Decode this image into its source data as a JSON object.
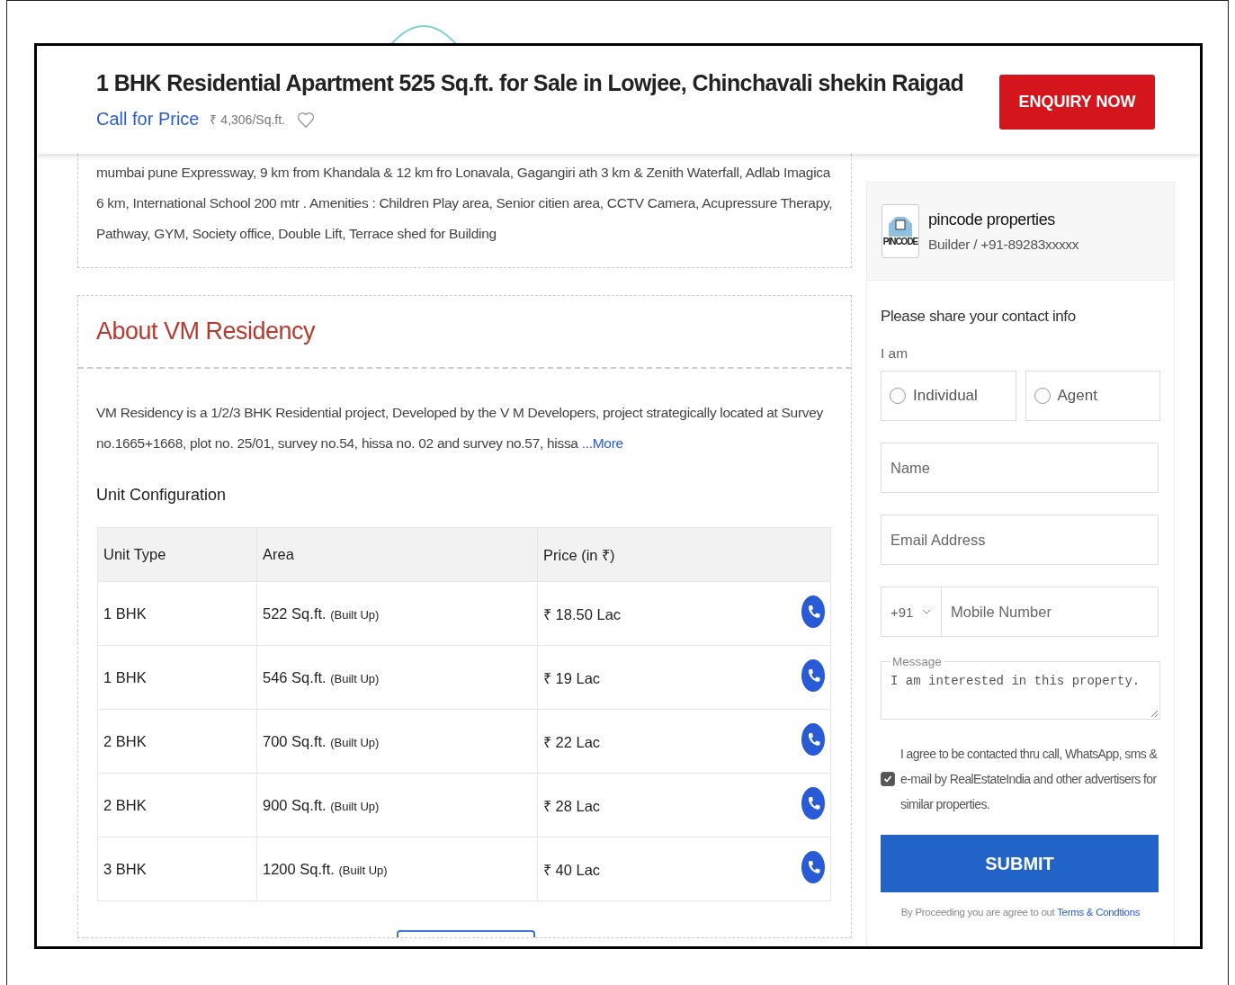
{
  "header": {
    "title": "1 BHK Residential Apartment 525 Sq.ft. for Sale in Lowjee, Chinchavali shekin Raigad",
    "price_label": "Call for Price",
    "price_per_sqft": "₹ 4,306/Sq.ft.",
    "enquiry_button": "ENQUIRY NOW"
  },
  "description": {
    "text": "mumbai pune Expressway, 9 km from Khandala & 12 km fro Lonavala, Gagangiri ath 3 km & Zenith Waterfall, Adlab Imagica 6 km, International School 200 mtr . Amenities : Children Play area, Senior citien area, CCTV Camera, Acupressure Therapy, Pathway, GYM, Society office, Double Lift, Terrace shed for Building"
  },
  "about": {
    "title": "About VM Residency",
    "text": "VM Residency is a 1/2/3 BHK Residential project, Developed by the V M Developers, project strategically located at Survey no.1665+1668, plot no. 25/01, survey no.54, hissa no. 02 and survey no.57, hissa",
    "more_link": "...More"
  },
  "unit_configuration": {
    "title": "Unit Configuration",
    "columns": [
      "Unit Type",
      "Area",
      "Price (in ₹)"
    ],
    "rows": [
      {
        "unit_type": "1 BHK",
        "area": "522 Sq.ft.",
        "area_note": "(Built Up)",
        "price": "₹ 18.50 Lac"
      },
      {
        "unit_type": "1 BHK",
        "area": "546 Sq.ft.",
        "area_note": "(Built Up)",
        "price": "₹ 19 Lac"
      },
      {
        "unit_type": "2 BHK",
        "area": "700 Sq.ft.",
        "area_note": "(Built Up)",
        "price": "₹ 22 Lac"
      },
      {
        "unit_type": "2 BHK",
        "area": "900 Sq.ft.",
        "area_note": "(Built Up)",
        "price": "₹ 28 Lac"
      },
      {
        "unit_type": "3 BHK",
        "area": "1200 Sq.ft.",
        "area_note": "(Built Up)",
        "price": "₹ 40 Lac"
      }
    ]
  },
  "seller": {
    "logo_text": "PINCODE",
    "name": "pincode properties",
    "subtitle": "Builder / +91-89283xxxxx"
  },
  "form": {
    "title": "Please share your contact info",
    "role_label": "I am",
    "roles": [
      {
        "label": "Individual",
        "selected": false
      },
      {
        "label": "Agent",
        "selected": false
      }
    ],
    "name_placeholder": "Name",
    "email_placeholder": "Email Address",
    "country_code": "+91",
    "mobile_placeholder": "Mobile Number",
    "message_label": "Message",
    "message_value": "I am interested in this property.",
    "consent": {
      "text": "I agree to be contacted thru call, WhatsApp, sms & e-mail by RealEstateIndia and other advertisers for similar properties.",
      "checked": true
    },
    "submit": "SUBMIT",
    "footer_text": "By Proceeding you are agree to out",
    "terms_link": "Terms & Condtions"
  }
}
